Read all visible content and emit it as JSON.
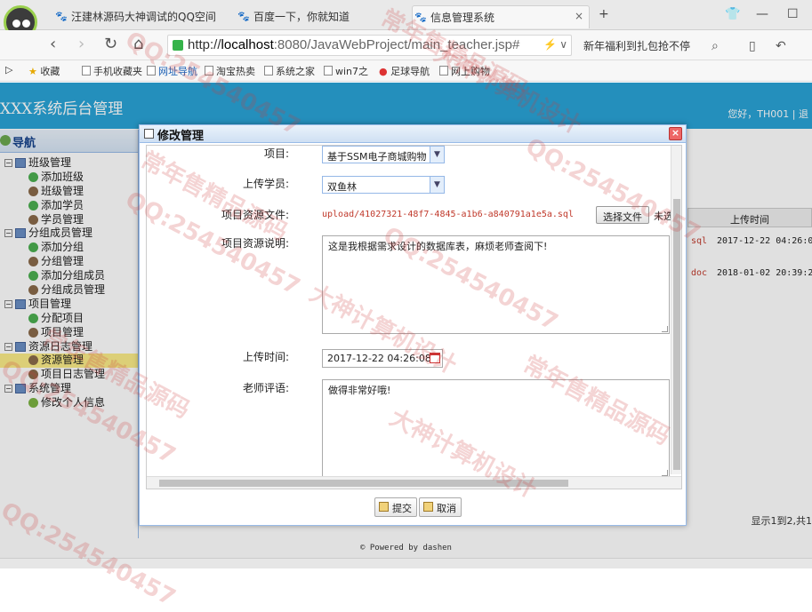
{
  "browser": {
    "tabs": [
      {
        "label": "汪建林源码大神调试的QQ空间"
      },
      {
        "label": "百度一下，你就知道"
      },
      {
        "label": "信息管理系统"
      }
    ],
    "url_scheme": "http://",
    "url_host": "localhost",
    "url_rest": ":8080/JavaWebProject/main_teacher.jsp#",
    "news_text": "新年福利到扎包抢不停",
    "bookmarks": [
      "收藏",
      "手机收藏夹",
      "网址导航",
      "淘宝热卖",
      "系统之家",
      "win7之",
      "足球导航",
      "网上购物"
    ]
  },
  "app": {
    "title": "XXX系统后台管理",
    "welcome": "您好，TH001 | 退"
  },
  "sidebar": {
    "header": "导航",
    "groups": [
      {
        "label": "班级管理",
        "items": [
          "添加班级",
          "班级管理",
          "添加学员",
          "学员管理"
        ]
      },
      {
        "label": "分组成员管理",
        "items": [
          "添加分组",
          "分组管理",
          "添加分组成员",
          "分组成员管理"
        ]
      },
      {
        "label": "项目管理",
        "items": [
          "分配项目",
          "项目管理"
        ]
      },
      {
        "label": "资源日志管理",
        "items": [
          "资源管理",
          "项目日志管理"
        ]
      },
      {
        "label": "系统管理",
        "items": [
          "修改个人信息"
        ]
      }
    ]
  },
  "grid": {
    "header_upload_time": "上传时间",
    "rows": [
      {
        "type": "sql",
        "time": "2017-12-22 04:26:0"
      },
      {
        "type": "doc",
        "time": "2018-01-02 20:39:2"
      }
    ],
    "pager": "显示1到2,共1"
  },
  "dialog": {
    "title": "修改管理",
    "close": "×",
    "fields": {
      "project_label": "项目:",
      "project_value": "基于SSM电子商城购物",
      "student_label": "上传学员:",
      "student_value": "双鱼林",
      "file_label": "项目资源文件:",
      "file_path": "upload/41027321-48f7-4845-a1b6-a840791a1e5a.sql",
      "choose_file": "选择文件",
      "file_status": "未选",
      "desc_label": "项目资源说明:",
      "desc_value": "这是我根据需求设计的数据库表，麻烦老师查阅下!",
      "time_label": "上传时间:",
      "time_value": "2017-12-22 04:26:08",
      "comment_label": "老师评语:",
      "comment_value": "做得非常好哦!"
    },
    "submit": "提交",
    "cancel": "取消"
  },
  "footer": "© Powered by dashen",
  "watermarks": [
    "QQ:254540457",
    "常年售精品源码",
    "大神计算机设计"
  ]
}
